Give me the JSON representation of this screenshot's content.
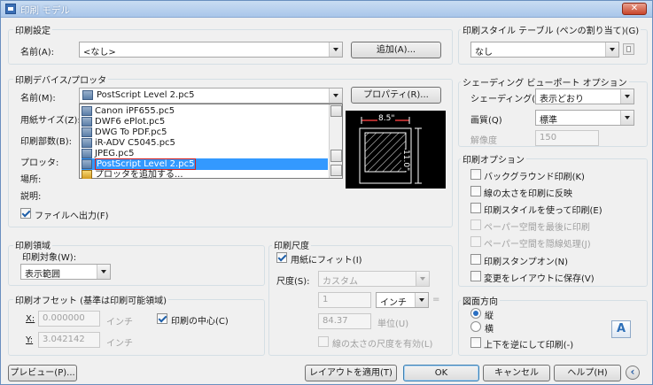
{
  "window": {
    "title": "印刷 モデル",
    "close": "✕"
  },
  "print_settings": {
    "group_title": "印刷設定",
    "name_label": "名前(A):",
    "name_value": "<なし>",
    "add_button": "追加(A)..."
  },
  "device": {
    "group_title": "印刷デバイス/プロッタ",
    "name_label": "名前(M):",
    "name_value": "PostScript Level 2.pc5",
    "properties_button": "プロパティ(R)...",
    "paper_size_label": "用紙サイズ(Z):",
    "copies_label": "印刷部数(B):",
    "plotter_label": "プロッタ:",
    "location_label": "場所:",
    "description_label": "説明:",
    "print_to_file": "ファイルへ出力(F)",
    "print_to_file_checked": true,
    "dropdown_items": [
      {
        "label": "Canon iPF655.pc5",
        "selected": false
      },
      {
        "label": "DWF6 ePlot.pc5",
        "selected": false
      },
      {
        "label": "DWG To PDF.pc5",
        "selected": false
      },
      {
        "label": "iR-ADV C5045.pc5",
        "selected": false
      },
      {
        "label": "JPEG.pc5",
        "selected": false
      },
      {
        "label": "PostScript Level 2.pc5",
        "selected": true
      },
      {
        "label": "プロッタを追加する...",
        "selected": false
      }
    ],
    "preview": {
      "width_label": "8.5\"",
      "height_label": "11.0\""
    }
  },
  "plot_area": {
    "group_title": "印刷領域",
    "what_label": "印刷対象(W):",
    "what_value": "表示範囲"
  },
  "plot_offset": {
    "group_title": "印刷オフセット (基準は印刷可能領域)",
    "x_label": "X:",
    "x_value": "0.000000",
    "y_label": "Y:",
    "y_value": "3.042142",
    "unit": "インチ",
    "center": "印刷の中心(C)",
    "center_checked": true
  },
  "plot_scale": {
    "group_title": "印刷尺度",
    "fit_paper": "用紙にフィット(I)",
    "fit_checked": true,
    "scale_label": "尺度(S):",
    "scale_value": "カスタム",
    "value1": "1",
    "unit_value": "インチ",
    "equals": "=",
    "value2": "84.37",
    "unit_label": "単位(U)",
    "scale_lineweights": "線の太さの尺度を有効(L)"
  },
  "plot_style": {
    "group_title": "印刷スタイル テーブル (ペンの割り当て)(G)",
    "value": "なし"
  },
  "shaded": {
    "group_title": "シェーディング ビューポート オプション",
    "shade_label": "シェーディング(D)",
    "shade_value": "表示どおり",
    "quality_label": "画質(Q)",
    "quality_value": "標準",
    "dpi_label": "解像度",
    "dpi_value": "150"
  },
  "options": {
    "group_title": "印刷オプション",
    "items": [
      {
        "label": "バックグラウンド印刷(K)",
        "checked": false,
        "enabled": true
      },
      {
        "label": "線の太さを印刷に反映",
        "checked": false,
        "enabled": true
      },
      {
        "label": "印刷スタイルを使って印刷(E)",
        "checked": false,
        "enabled": true
      },
      {
        "label": "ペーパー空間を最後に印刷",
        "checked": false,
        "enabled": false
      },
      {
        "label": "ペーパー空間を隠線処理(J)",
        "checked": false,
        "enabled": false
      },
      {
        "label": "印刷スタンプオン(N)",
        "checked": false,
        "enabled": true
      },
      {
        "label": "変更をレイアウトに保存(V)",
        "checked": false,
        "enabled": true
      }
    ]
  },
  "orientation": {
    "group_title": "図面方向",
    "portrait": "縦",
    "landscape": "横",
    "upside_down": "上下を逆にして印刷(-)",
    "portrait_selected": true,
    "landscape_icon": "A"
  },
  "footer": {
    "preview": "プレビュー(P)...",
    "apply_layout": "レイアウトを適用(T)",
    "ok": "OK",
    "cancel": "キャンセル",
    "help": "ヘルプ(H)",
    "expand": "‹"
  }
}
